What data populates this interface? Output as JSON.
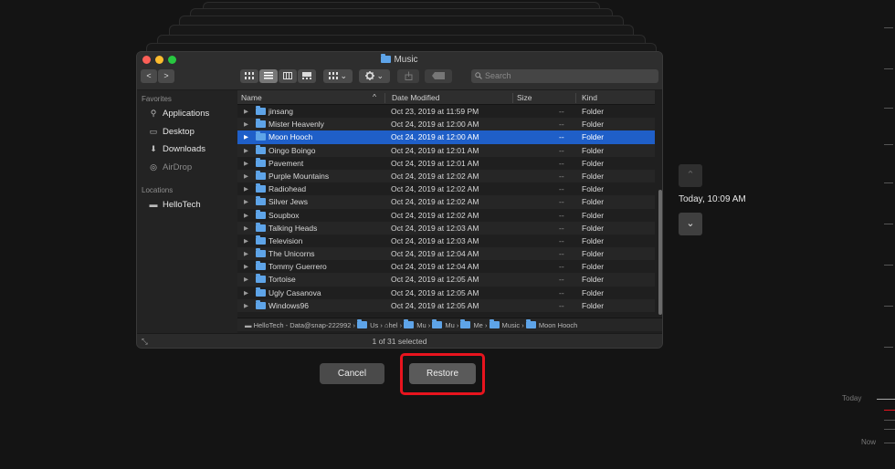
{
  "window": {
    "title": "Music",
    "search_placeholder": "Search",
    "nav_back": "<",
    "nav_fwd": ">",
    "gear_chevron": "⌄",
    "group_chevron": "⌄"
  },
  "sidebar": {
    "favorites_heading": "Favorites",
    "favorites": [
      {
        "label": "Applications",
        "icon": "applications-icon"
      },
      {
        "label": "Desktop",
        "icon": "desktop-icon"
      },
      {
        "label": "Downloads",
        "icon": "downloads-icon"
      },
      {
        "label": "AirDrop",
        "icon": "airdrop-icon"
      }
    ],
    "locations_heading": "Locations",
    "locations": [
      {
        "label": "HelloTech",
        "icon": "disk-icon"
      }
    ]
  },
  "columns": {
    "name": "Name",
    "date": "Date Modified",
    "size": "Size",
    "kind": "Kind"
  },
  "rows": [
    {
      "name": "jinsang",
      "date": "Oct 23, 2019 at 11:59 PM",
      "size": "--",
      "kind": "Folder"
    },
    {
      "name": "Mister Heavenly",
      "date": "Oct 24, 2019 at 12:00 AM",
      "size": "--",
      "kind": "Folder"
    },
    {
      "name": "Moon Hooch",
      "date": "Oct 24, 2019 at 12:00 AM",
      "size": "--",
      "kind": "Folder"
    },
    {
      "name": "Oingo Boingo",
      "date": "Oct 24, 2019 at 12:01 AM",
      "size": "--",
      "kind": "Folder"
    },
    {
      "name": "Pavement",
      "date": "Oct 24, 2019 at 12:01 AM",
      "size": "--",
      "kind": "Folder"
    },
    {
      "name": "Purple Mountains",
      "date": "Oct 24, 2019 at 12:02 AM",
      "size": "--",
      "kind": "Folder"
    },
    {
      "name": "Radiohead",
      "date": "Oct 24, 2019 at 12:02 AM",
      "size": "--",
      "kind": "Folder"
    },
    {
      "name": "Silver Jews",
      "date": "Oct 24, 2019 at 12:02 AM",
      "size": "--",
      "kind": "Folder"
    },
    {
      "name": "Soupbox",
      "date": "Oct 24, 2019 at 12:02 AM",
      "size": "--",
      "kind": "Folder"
    },
    {
      "name": "Talking Heads",
      "date": "Oct 24, 2019 at 12:03 AM",
      "size": "--",
      "kind": "Folder"
    },
    {
      "name": "Television",
      "date": "Oct 24, 2019 at 12:03 AM",
      "size": "--",
      "kind": "Folder"
    },
    {
      "name": "The Unicorns",
      "date": "Oct 24, 2019 at 12:04 AM",
      "size": "--",
      "kind": "Folder"
    },
    {
      "name": "Tommy Guerrero",
      "date": "Oct 24, 2019 at 12:04 AM",
      "size": "--",
      "kind": "Folder"
    },
    {
      "name": "Tortoise",
      "date": "Oct 24, 2019 at 12:05 AM",
      "size": "--",
      "kind": "Folder"
    },
    {
      "name": "Ugly Casanova",
      "date": "Oct 24, 2019 at 12:05 AM",
      "size": "--",
      "kind": "Folder"
    },
    {
      "name": "Windows96",
      "date": "Oct 24, 2019 at 12:05 AM",
      "size": "--",
      "kind": "Folder"
    }
  ],
  "selected_row": 2,
  "pathbar": [
    "HelloTech - Data@snap-222992",
    "Us",
    "hel",
    "Mu",
    "Mu",
    "Me",
    "Music",
    "Moon Hooch"
  ],
  "status": "1 of 31 selected",
  "buttons": {
    "cancel": "Cancel",
    "restore": "Restore"
  },
  "timemachine": {
    "date": "Today, 10:09 AM",
    "up_glyph": "⌃",
    "down_glyph": "⌄",
    "timeline_today": "Today",
    "timeline_now": "Now"
  },
  "colors": {
    "selection": "#1f5fc8",
    "folder": "#5ea4e8",
    "highlight": "#e8141e"
  }
}
